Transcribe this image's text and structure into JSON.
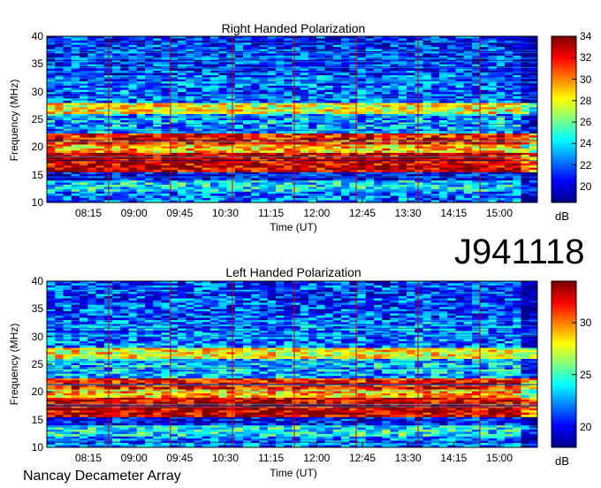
{
  "chart_data": [
    {
      "type": "heatmap",
      "title": "Right Handed Polarization",
      "xlabel": "Time (UT)",
      "ylabel": "Frequency (MHz)",
      "x_ticks": [
        "08:15",
        "09:00",
        "09:45",
        "10:30",
        "11:15",
        "12:00",
        "12:45",
        "13:30",
        "14:15",
        "15:00"
      ],
      "y_ticks": [
        10,
        15,
        20,
        25,
        30,
        35,
        40
      ],
      "ylim": [
        10,
        40
      ],
      "colorbar": {
        "ticks": [
          20,
          22,
          24,
          26,
          28,
          30,
          32,
          34
        ],
        "range": [
          18.5,
          34
        ],
        "unit": "dB"
      },
      "bands": [
        {
          "from": 10,
          "to": 12,
          "level": 22
        },
        {
          "from": 12,
          "to": 14,
          "level": 24
        },
        {
          "from": 14,
          "to": 15.5,
          "level": 20
        },
        {
          "from": 15.5,
          "to": 19,
          "level": 33
        },
        {
          "from": 19,
          "to": 20.5,
          "level": 29
        },
        {
          "from": 20.5,
          "to": 22.5,
          "level": 32
        },
        {
          "from": 22.5,
          "to": 26,
          "level": 23
        },
        {
          "from": 26,
          "to": 28,
          "level": 28
        },
        {
          "from": 28,
          "to": 33,
          "level": 22
        },
        {
          "from": 33,
          "to": 40,
          "level": 21
        }
      ],
      "colormap": [
        "#00008f",
        "#0000ff",
        "#0080ff",
        "#00ffff",
        "#80ff80",
        "#ffff00",
        "#ff8000",
        "#ff0000",
        "#800000"
      ]
    },
    {
      "type": "heatmap",
      "title": "Left Handed Polarization",
      "xlabel": "Time (UT)",
      "ylabel": "Frequency (MHz)",
      "x_ticks": [
        "08:15",
        "09:00",
        "09:45",
        "10:30",
        "11:15",
        "12:00",
        "12:45",
        "13:30",
        "14:15",
        "15:00"
      ],
      "y_ticks": [
        10,
        15,
        20,
        25,
        30,
        35,
        40
      ],
      "ylim": [
        10,
        40
      ],
      "colorbar": {
        "ticks": [
          20,
          25,
          30
        ],
        "range": [
          18,
          34
        ],
        "unit": "dB"
      },
      "bands": [
        {
          "from": 10,
          "to": 12,
          "level": 22
        },
        {
          "from": 12,
          "to": 14,
          "level": 24
        },
        {
          "from": 14,
          "to": 15.5,
          "level": 20
        },
        {
          "from": 15.5,
          "to": 19,
          "level": 33
        },
        {
          "from": 19,
          "to": 20.5,
          "level": 29
        },
        {
          "from": 20.5,
          "to": 22.5,
          "level": 32
        },
        {
          "from": 22.5,
          "to": 26,
          "level": 23
        },
        {
          "from": 26,
          "to": 28,
          "level": 28
        },
        {
          "from": 28,
          "to": 33,
          "level": 22
        },
        {
          "from": 33,
          "to": 40,
          "level": 21
        }
      ],
      "colormap": [
        "#00008f",
        "#0000ff",
        "#0080ff",
        "#00ffff",
        "#80ff80",
        "#ffff00",
        "#ff8000",
        "#ff0000",
        "#800000"
      ]
    }
  ],
  "observation_id": "J941118",
  "footer": "Nancay Decameter Array"
}
